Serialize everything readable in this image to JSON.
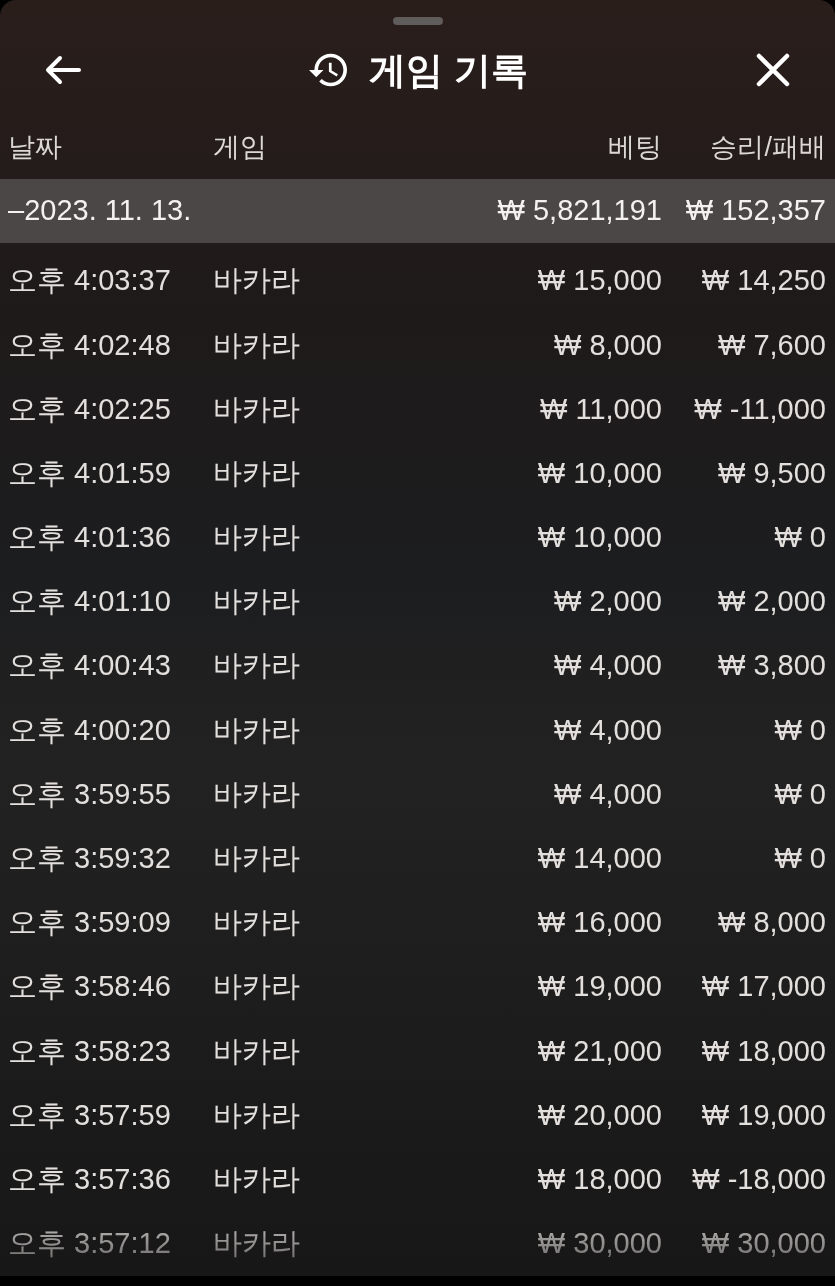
{
  "header": {
    "title": "게임 기록"
  },
  "table": {
    "columns": [
      "날짜",
      "게임",
      "베팅",
      "승리/패배"
    ],
    "groups": [
      {
        "date": "–2023. 11. 13.",
        "bet_total": "₩ 5,821,191",
        "win_loss_total": "₩ 152,357",
        "rows": [
          {
            "time": "오후 4:03:37",
            "game": "바카라",
            "bet": "₩ 15,000",
            "win_loss": "₩ 14,250"
          },
          {
            "time": "오후 4:02:48",
            "game": "바카라",
            "bet": "₩ 8,000",
            "win_loss": "₩ 7,600"
          },
          {
            "time": "오후 4:02:25",
            "game": "바카라",
            "bet": "₩ 11,000",
            "win_loss": "₩ -11,000"
          },
          {
            "time": "오후 4:01:59",
            "game": "바카라",
            "bet": "₩ 10,000",
            "win_loss": "₩ 9,500"
          },
          {
            "time": "오후 4:01:36",
            "game": "바카라",
            "bet": "₩ 10,000",
            "win_loss": "₩ 0"
          },
          {
            "time": "오후 4:01:10",
            "game": "바카라",
            "bet": "₩ 2,000",
            "win_loss": "₩ 2,000"
          },
          {
            "time": "오후 4:00:43",
            "game": "바카라",
            "bet": "₩ 4,000",
            "win_loss": "₩ 3,800"
          },
          {
            "time": "오후 4:00:20",
            "game": "바카라",
            "bet": "₩ 4,000",
            "win_loss": "₩ 0"
          },
          {
            "time": "오후 3:59:55",
            "game": "바카라",
            "bet": "₩ 4,000",
            "win_loss": "₩ 0"
          },
          {
            "time": "오후 3:59:32",
            "game": "바카라",
            "bet": "₩ 14,000",
            "win_loss": "₩ 0"
          },
          {
            "time": "오후 3:59:09",
            "game": "바카라",
            "bet": "₩ 16,000",
            "win_loss": "₩ 8,000"
          },
          {
            "time": "오후 3:58:46",
            "game": "바카라",
            "bet": "₩ 19,000",
            "win_loss": "₩ 17,000"
          },
          {
            "time": "오후 3:58:23",
            "game": "바카라",
            "bet": "₩ 21,000",
            "win_loss": "₩ 18,000"
          },
          {
            "time": "오후 3:57:59",
            "game": "바카라",
            "bet": "₩ 20,000",
            "win_loss": "₩ 19,000"
          },
          {
            "time": "오후 3:57:36",
            "game": "바카라",
            "bet": "₩ 18,000",
            "win_loss": "₩ -18,000"
          },
          {
            "time": "오후 3:57:12",
            "game": "바카라",
            "bet": "₩ 30,000",
            "win_loss": "₩ 30,000"
          }
        ]
      }
    ]
  }
}
